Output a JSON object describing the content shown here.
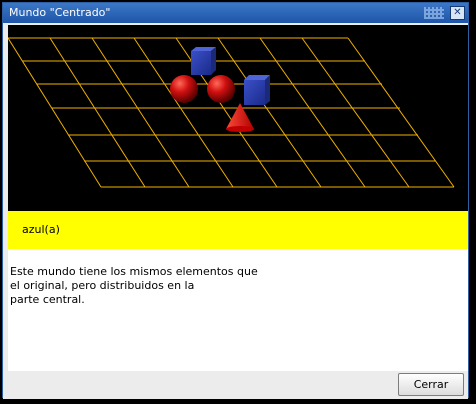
{
  "window": {
    "title": "Mundo \"Centrado\"",
    "close_glyph": "✕"
  },
  "scene": {
    "grid_color": "#f0b000",
    "sphere_color": "#d01010",
    "cube_color": "#2a3faa",
    "cone_color": "#e81010",
    "objects": [
      "blue-cube",
      "red-sphere",
      "red-sphere",
      "blue-cube",
      "red-cone"
    ]
  },
  "status": {
    "text": "azul(a)"
  },
  "description": {
    "text": "Este mundo tiene los mismos elementos que\nel original, pero distribuidos en la\nparte central."
  },
  "footer": {
    "close_label": "Cerrar"
  }
}
